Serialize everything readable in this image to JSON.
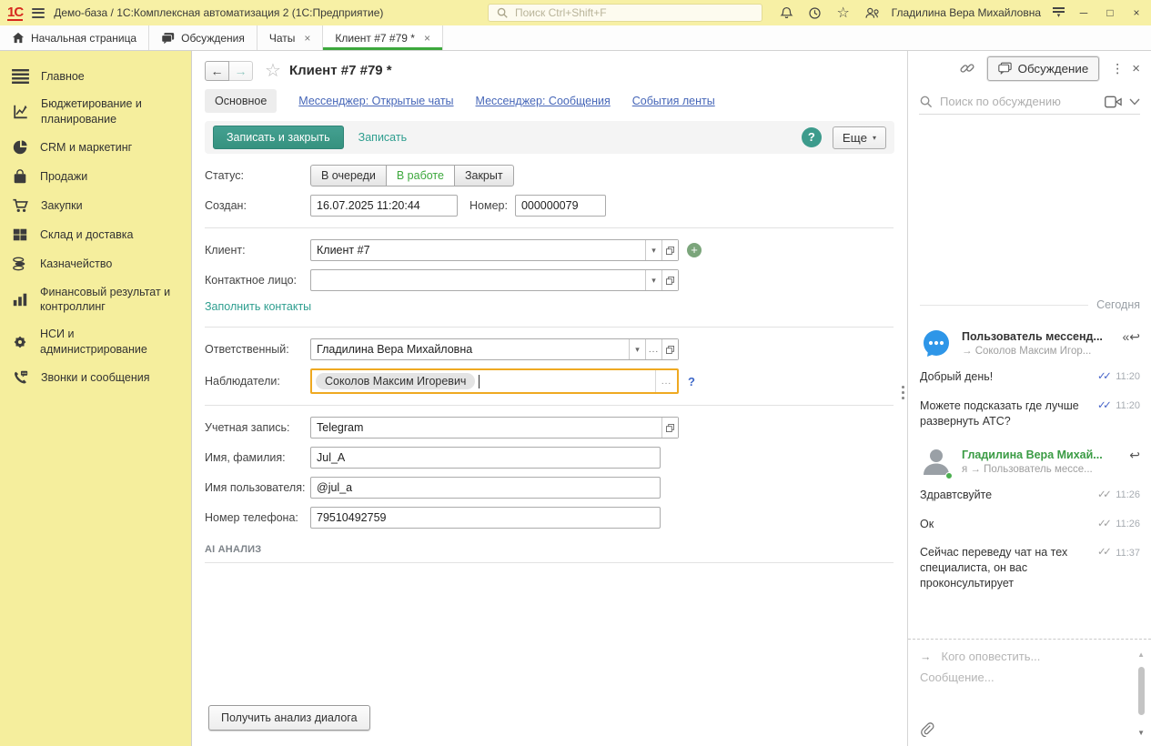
{
  "colors": {
    "titlebar_yellow": "#F7F0A5",
    "sidebar_yellow": "#F5EE9D",
    "brand_red": "#D6281E",
    "accent_teal": "#3D9B8C",
    "active_green": "#3CA83C",
    "link_blue": "#4666B8",
    "focus_orange": "#EFA921",
    "check_blue": "#4663C9",
    "name_green": "#3A9B44",
    "avatar_blue": "#2E96E8"
  },
  "glyphs": {
    "back": "←",
    "forward": "→",
    "star": "☆",
    "close": "×",
    "minimize": "─",
    "maximize": "□",
    "dropdown": "▾",
    "ellipsis": "...",
    "more_vertical": "⋮",
    "plus": "+",
    "double_check": "✓✓",
    "reply": "↩",
    "reply_all": "«↩",
    "arrow_right": "→",
    "scroll_up": "▲",
    "scroll_down": "▼"
  },
  "titlebar": {
    "logo": "1С",
    "title": "Демо-база / 1С:Комплексная автоматизация 2  (1С:Предприятие)",
    "search_placeholder": "Поиск Ctrl+Shift+F",
    "user": "Гладилина Вера Михайловна"
  },
  "tabbar": {
    "tabs": [
      {
        "label": "Начальная страница"
      },
      {
        "label": "Обсуждения"
      },
      {
        "label": "Чаты"
      },
      {
        "label": "Клиент #7 #79 *"
      }
    ]
  },
  "sidebar": {
    "items": [
      {
        "label": "Главное"
      },
      {
        "label": "Бюджетирование и планирование"
      },
      {
        "label": "CRM и маркетинг"
      },
      {
        "label": "Продажи"
      },
      {
        "label": "Закупки"
      },
      {
        "label": "Склад и доставка"
      },
      {
        "label": "Казначейство"
      },
      {
        "label": "Финансовый результат и контроллинг"
      },
      {
        "label": "НСИ и администрирование"
      },
      {
        "label": "Звонки и сообщения"
      }
    ]
  },
  "form": {
    "title": "Клиент #7 #79 *",
    "nav": {
      "active": "Основное",
      "links": [
        "Мессенджер: Открытые чаты",
        "Мессенджер: Сообщения",
        "События ленты"
      ]
    },
    "toolbar": {
      "save_close": "Записать и закрыть",
      "save": "Записать",
      "help": "?",
      "more": "Еще"
    },
    "fields": {
      "status": {
        "label": "Статус:",
        "options": [
          "В очереди",
          "В работе",
          "Закрыт"
        ],
        "selected": "В работе"
      },
      "created": {
        "label": "Создан:",
        "value": "16.07.2025 11:20:44"
      },
      "number": {
        "label": "Номер:",
        "value": "000000079"
      },
      "client": {
        "label": "Клиент:",
        "value": "Клиент #7"
      },
      "contact": {
        "label": "Контактное лицо:",
        "value": ""
      },
      "fill_contacts": "Заполнить контакты",
      "responsible": {
        "label": "Ответственный:",
        "value": "Гладилина Вера Михайловна"
      },
      "watchers": {
        "label": "Наблюдатели:",
        "tag": "Соколов Максим Игоревич",
        "help": "?"
      },
      "account": {
        "label": "Учетная запись:",
        "value": "Telegram"
      },
      "fullname": {
        "label": "Имя, фамилия:",
        "value": "Jul_A"
      },
      "username": {
        "label": "Имя пользователя:",
        "value": "@jul_a"
      },
      "phone": {
        "label": "Номер телефона:",
        "value": "79510492759"
      }
    },
    "ai_section": "AI АНАЛИЗ",
    "analyze_button": "Получить анализ диалога"
  },
  "discussion": {
    "panel_button": "Обсуждение",
    "search_placeholder": "Поиск по обсуждению",
    "date_divider": "Сегодня",
    "groups": [
      {
        "sender": "Пользователь мессенд...",
        "route": "→ Соколов Максим Игор...",
        "messages": [
          {
            "text": "Добрый день!",
            "time": "11:20"
          },
          {
            "text": "Можете подсказать где лучше развернуть АТС?",
            "time": "11:20"
          }
        ]
      },
      {
        "sender": "Гладилина Вера Михай...",
        "route": "я → Пользователь мессе...",
        "messages": [
          {
            "text": "Здравтсвуйте",
            "time": "11:26"
          },
          {
            "text": "Ок",
            "time": "11:26"
          },
          {
            "text": "Сейчас переведу чат на тех специалиста, он вас проконсультирует",
            "time": "11:37"
          }
        ]
      }
    ],
    "compose": {
      "notify_placeholder": "Кого оповестить...",
      "message_placeholder": "Сообщение..."
    }
  }
}
